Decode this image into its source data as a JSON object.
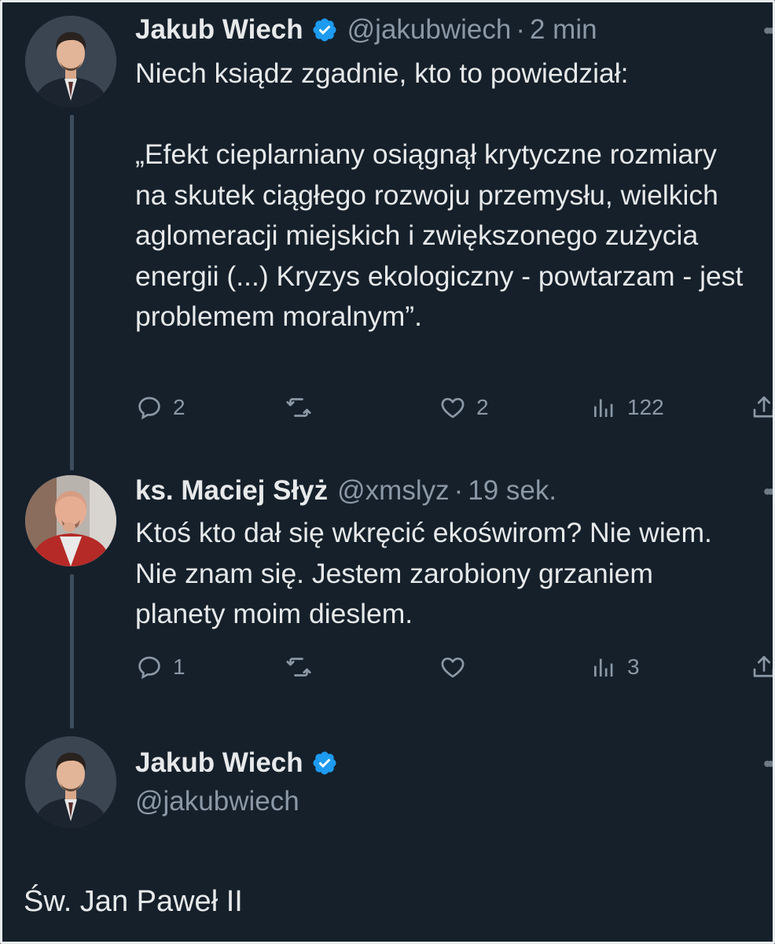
{
  "tweets": [
    {
      "author_name": "Jakub Wiech",
      "handle": "@jakubwiech",
      "time": "2 min",
      "text": "Niech ksiądz zgadnie, kto to powiedział:\n\n„Efekt cieplarniany osiągnął krytyczne rozmiary na skutek ciągłego rozwoju przemysłu, wielkich aglomeracji miejskich i zwiększonego zużycia energii (...) Kryzys ekologiczny - powtarzam - jest problemem moralnym”.",
      "stats": {
        "replies": "2",
        "retweets": "",
        "likes": "2",
        "views": "122"
      }
    },
    {
      "author_name": "ks. Maciej Słyż",
      "handle": "@xmslyz",
      "time": "19 sek.",
      "text": "Ktoś kto dał się wkręcić ekoświrom? Nie wiem. Nie znam się. Jestem zarobiony grzaniem planety moim dieslem.",
      "stats": {
        "replies": "1",
        "retweets": "",
        "likes": "",
        "views": "3"
      }
    }
  ],
  "reply_compose": {
    "author_name": "Jakub Wiech",
    "handle": "@jakubwiech"
  },
  "final_text": "Św. Jan Paweł II",
  "separator_dot": "·",
  "icons": {
    "reply": "speech-bubble-icon",
    "retweet": "retweet-icon",
    "like": "heart-icon",
    "views": "bar-chart-icon",
    "share": "share-icon",
    "more": "more-dots-icon",
    "verified": "verified-badge-icon"
  },
  "colors": {
    "background": "#15202b",
    "text_primary": "#e7e9ea",
    "text_secondary": "#8b98a5",
    "verified": "#1d9bf0",
    "thread_line": "#3d4d5c"
  }
}
